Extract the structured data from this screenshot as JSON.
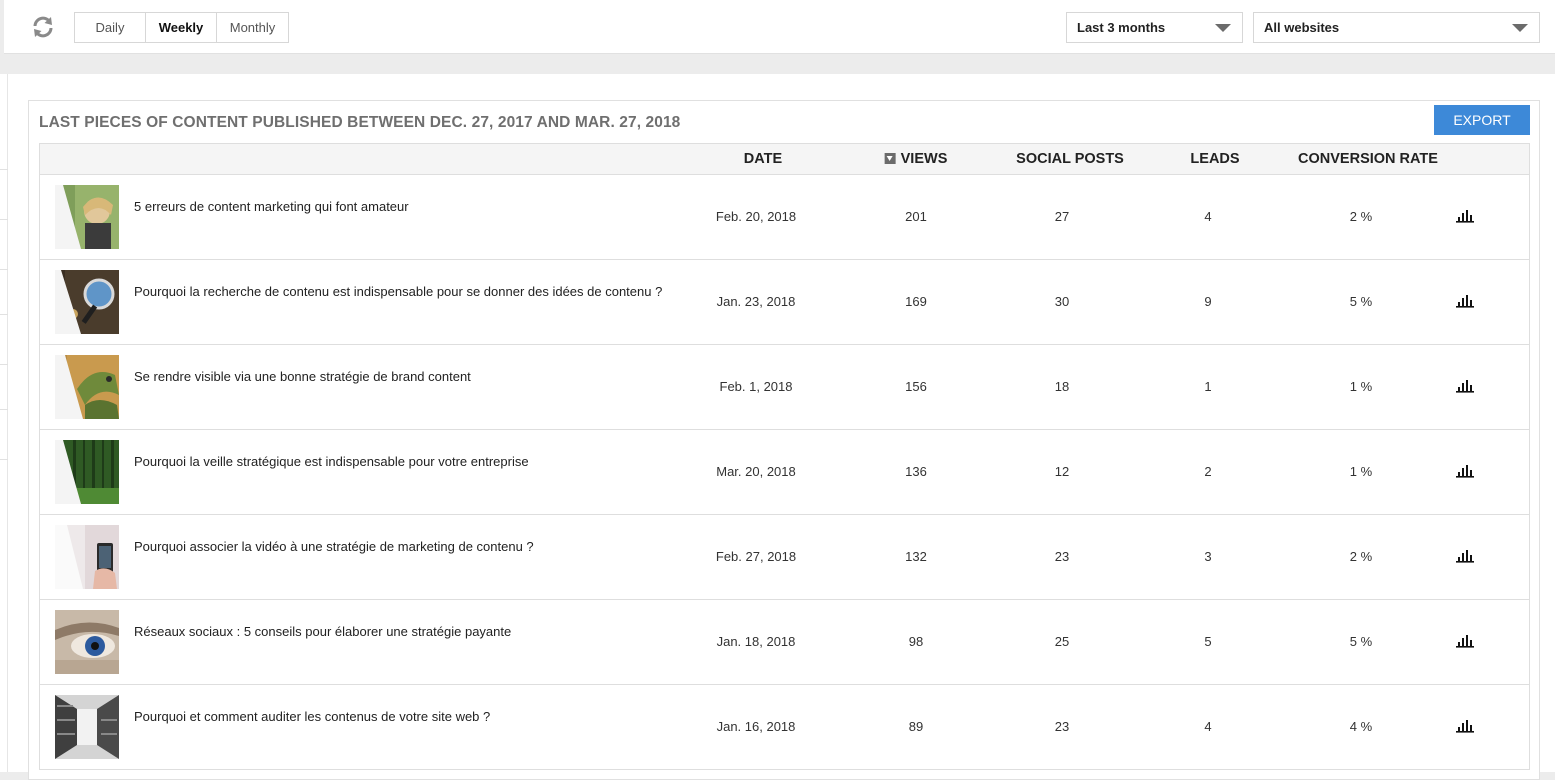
{
  "toolbar": {
    "periods": [
      "Daily",
      "Weekly",
      "Monthly"
    ],
    "active_period": "Weekly",
    "range_select": "Last 3 months",
    "site_select": "All websites"
  },
  "panel": {
    "title": "LAST PIECES OF CONTENT PUBLISHED BETWEEN DEC. 27, 2017 AND MAR. 27, 2018",
    "export_label": "EXPORT",
    "accent": "#3d89d8"
  },
  "table": {
    "columns": [
      "DATE",
      "VIEWS",
      "SOCIAL POSTS",
      "LEADS",
      "CONVERSION RATE"
    ],
    "sorted_by": "VIEWS",
    "rows": [
      {
        "title": "5 erreurs de content marketing qui font amateur",
        "date": "Feb. 20, 2018",
        "views": "201",
        "social_posts": "27",
        "leads": "4",
        "conversion_rate": "2 %",
        "thumb": "portrait-photo"
      },
      {
        "title": "Pourquoi la recherche de contenu est indispensable pour se donner des idées de contenu ?",
        "date": "Jan. 23, 2018",
        "views": "169",
        "social_posts": "30",
        "leads": "9",
        "conversion_rate": "5 %",
        "thumb": "magnifying-glass-photo"
      },
      {
        "title": "Se rendre visible via une bonne stratégie de brand content",
        "date": "Feb. 1, 2018",
        "views": "156",
        "social_posts": "18",
        "leads": "1",
        "conversion_rate": "1 %",
        "thumb": "iguana-photo"
      },
      {
        "title": "Pourquoi la veille stratégique est indispensable pour votre entreprise",
        "date": "Mar. 20, 2018",
        "views": "136",
        "social_posts": "12",
        "leads": "2",
        "conversion_rate": "1 %",
        "thumb": "forest-photo"
      },
      {
        "title": "Pourquoi associer la vidéo à une stratégie de marketing de contenu ?",
        "date": "Feb. 27, 2018",
        "views": "132",
        "social_posts": "23",
        "leads": "3",
        "conversion_rate": "2 %",
        "thumb": "phone-video-photo"
      },
      {
        "title": "Réseaux sociaux : 5 conseils pour élaborer une stratégie payante",
        "date": "Jan. 18, 2018",
        "views": "98",
        "social_posts": "25",
        "leads": "5",
        "conversion_rate": "5 %",
        "thumb": "eye-photo"
      },
      {
        "title": "Pourquoi et comment auditer les contenus de votre site web ?",
        "date": "Jan. 16, 2018",
        "views": "89",
        "social_posts": "23",
        "leads": "4",
        "conversion_rate": "4 %",
        "thumb": "archive-shelves-photo"
      }
    ]
  }
}
